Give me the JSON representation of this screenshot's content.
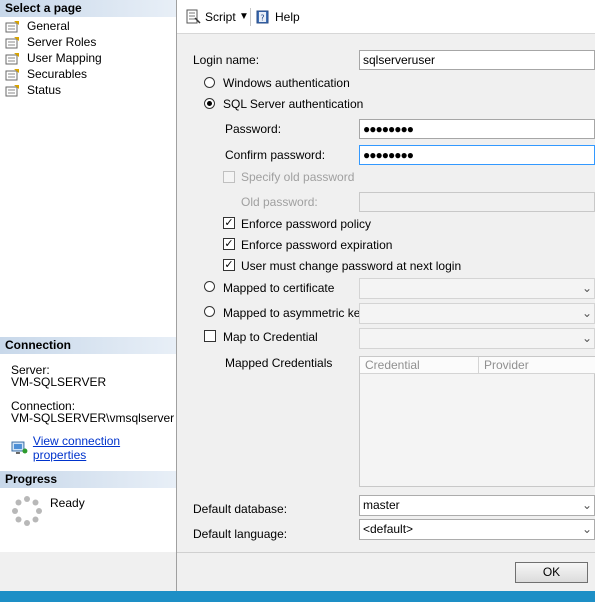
{
  "left_panel": {
    "select_page_title": "Select a page",
    "pages": [
      {
        "label": "General"
      },
      {
        "label": "Server Roles"
      },
      {
        "label": "User Mapping"
      },
      {
        "label": "Securables"
      },
      {
        "label": "Status"
      }
    ],
    "connection": {
      "title": "Connection",
      "server_label": "Server:",
      "server_value": "VM-SQLSERVER",
      "connection_label": "Connection:",
      "connection_value": "VM-SQLSERVER\\vmsqlserver",
      "view_properties_link": "View connection properties"
    },
    "progress": {
      "title": "Progress",
      "status": "Ready"
    }
  },
  "toolbar": {
    "script_label": "Script",
    "help_label": "Help"
  },
  "form": {
    "login_name_label": "Login name:",
    "login_name_value": "sqlserveruser",
    "windows_auth_label": "Windows authentication",
    "sql_auth_label": "SQL Server authentication",
    "password_label": "Password:",
    "password_value": "●●●●●●●●",
    "confirm_password_label": "Confirm password:",
    "confirm_password_value": "●●●●●●●●",
    "specify_old_password_label": "Specify old password",
    "old_password_label": "Old password:",
    "enforce_policy_label": "Enforce password policy",
    "enforce_expiration_label": "Enforce password expiration",
    "must_change_label": "User must change password at next login",
    "mapped_cert_label": "Mapped to certificate",
    "mapped_asym_label": "Mapped to asymmetric key",
    "map_credential_label": "Map to Credential",
    "mapped_credentials_label": "Mapped Credentials",
    "grid_headers": [
      "Credential",
      "Provider"
    ],
    "default_database_label": "Default database:",
    "default_database_value": "master",
    "default_language_label": "Default language:",
    "default_language_value": "<default>"
  },
  "footer": {
    "ok_label": "OK"
  }
}
